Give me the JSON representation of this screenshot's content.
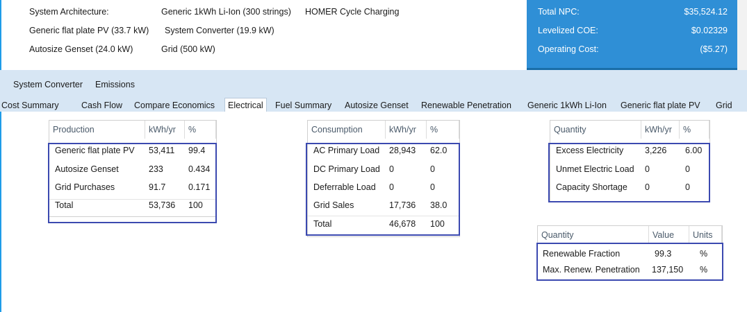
{
  "architecture": {
    "label": "System Architecture:",
    "generic_pv": "Generic flat plate PV (33.7 kW)",
    "autosize_genset": "Autosize Genset (24.0 kW)",
    "battery": "Generic 1kWh Li-Ion (300 strings)",
    "system_converter": "System Converter (19.9 kW)",
    "grid": "Grid (500 kW)",
    "dispatch": "HOMER Cycle Charging"
  },
  "summary": {
    "total_npc_label": "Total NPC:",
    "total_npc_value": "$35,524.12",
    "coe_label": "Levelized COE:",
    "coe_value": "$0.02329",
    "operating_cost_label": "Operating Cost:",
    "operating_cost_value": "($5.27)"
  },
  "tabs_row1": [
    "System Converter",
    "Emissions"
  ],
  "tabs_row2": [
    "Cost Summary",
    "Cash Flow",
    "Compare Economics",
    "Electrical",
    "Fuel Summary",
    "Autosize Genset",
    "Renewable Penetration",
    "Generic 1kWh Li-Ion",
    "Generic flat plate PV",
    "Grid"
  ],
  "active_tab": "Electrical",
  "production": {
    "headers": [
      "Production",
      "kWh/yr",
      "%"
    ],
    "rows": [
      [
        "Generic flat plate PV",
        "53,411",
        "99.4"
      ],
      [
        "Autosize Genset",
        "233",
        "0.434"
      ],
      [
        "Grid Purchases",
        "91.7",
        "0.171"
      ],
      [
        "Total",
        "53,736",
        "100"
      ]
    ]
  },
  "consumption": {
    "headers": [
      "Consumption",
      "kWh/yr",
      "%"
    ],
    "rows": [
      [
        "AC Primary Load",
        "28,943",
        "62.0"
      ],
      [
        "DC Primary Load",
        "0",
        "0"
      ],
      [
        "Deferrable Load",
        "0",
        "0"
      ],
      [
        "Grid Sales",
        "17,736",
        "38.0"
      ],
      [
        "Total",
        "46,678",
        "100"
      ]
    ]
  },
  "quantity": {
    "headers": [
      "Quantity",
      "kWh/yr",
      "%"
    ],
    "rows": [
      [
        "Excess Electricity",
        "3,226",
        "6.00"
      ],
      [
        "Unmet Electric Load",
        "0",
        "0"
      ],
      [
        "Capacity Shortage",
        "0",
        "0"
      ]
    ]
  },
  "renewable": {
    "headers": [
      "Quantity",
      "Value",
      "Units"
    ],
    "rows": [
      [
        "Renewable Fraction",
        "99.3",
        "%"
      ],
      [
        "Max. Renew. Penetration",
        "137,150",
        "%"
      ]
    ]
  },
  "colors": {
    "accent_blue": "#2f8fd6",
    "tab_band": "#d7e6f4",
    "highlight_border": "#3b49b0"
  }
}
